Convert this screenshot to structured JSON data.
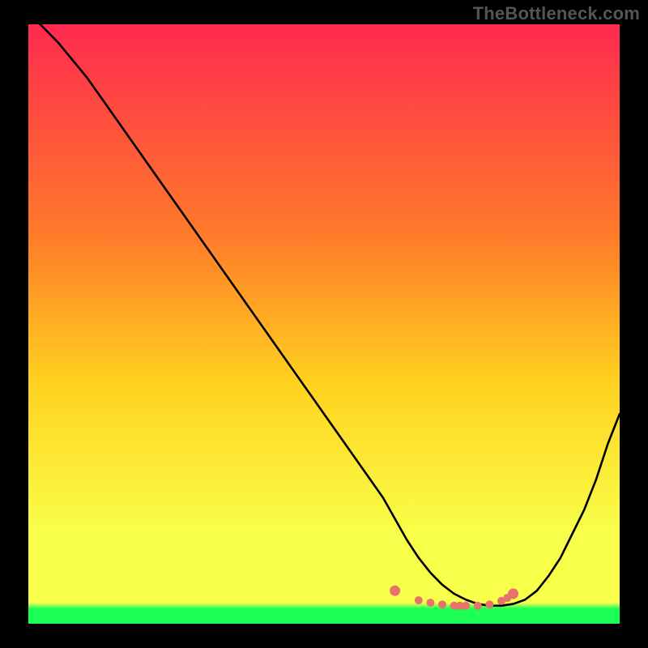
{
  "attribution": "TheBottleneck.com",
  "colors": {
    "top": "#ff2a4f",
    "mid_upper": "#ff7a2a",
    "mid": "#ffd21f",
    "lower": "#f8ff4a",
    "bottom": "#1cff55",
    "curve": "#000000",
    "marker": "#e6736c",
    "frame": "#000000"
  },
  "chart_data": {
    "type": "line",
    "title": "",
    "xlabel": "",
    "ylabel": "",
    "xlim": [
      0,
      100
    ],
    "ylim": [
      0,
      100
    ],
    "grid": false,
    "legend": false,
    "series": [
      {
        "name": "bottleneck-curve",
        "x": [
          0,
          5,
          10,
          15,
          20,
          25,
          30,
          35,
          40,
          45,
          50,
          55,
          60,
          62,
          64,
          66,
          68,
          70,
          72,
          74,
          76,
          78,
          80,
          82,
          84,
          86,
          88,
          90,
          92,
          94,
          96,
          98,
          100
        ],
        "y": [
          102,
          97,
          91,
          84,
          77,
          70,
          63,
          56,
          49,
          42,
          35,
          28,
          21,
          17.5,
          14,
          11,
          8.5,
          6.5,
          5,
          4,
          3.3,
          3,
          3,
          3.3,
          4,
          5.5,
          8,
          11,
          15,
          19,
          24,
          30,
          35
        ]
      }
    ],
    "markers": {
      "x": [
        62,
        66,
        68,
        70,
        72,
        73,
        74,
        76,
        78,
        80,
        81,
        82
      ],
      "y": [
        5.5,
        3.9,
        3.5,
        3.2,
        3.0,
        3.0,
        3.0,
        3.0,
        3.2,
        3.8,
        4.3,
        5.0
      ]
    },
    "gradient_stops": [
      {
        "offset": 0.0,
        "color_key": "top"
      },
      {
        "offset": 0.35,
        "color_key": "mid_upper"
      },
      {
        "offset": 0.6,
        "color_key": "mid"
      },
      {
        "offset": 0.85,
        "color_key": "lower"
      },
      {
        "offset": 0.965,
        "color_key": "lower"
      },
      {
        "offset": 0.975,
        "color_key": "bottom"
      },
      {
        "offset": 1.0,
        "color_key": "bottom"
      }
    ]
  }
}
